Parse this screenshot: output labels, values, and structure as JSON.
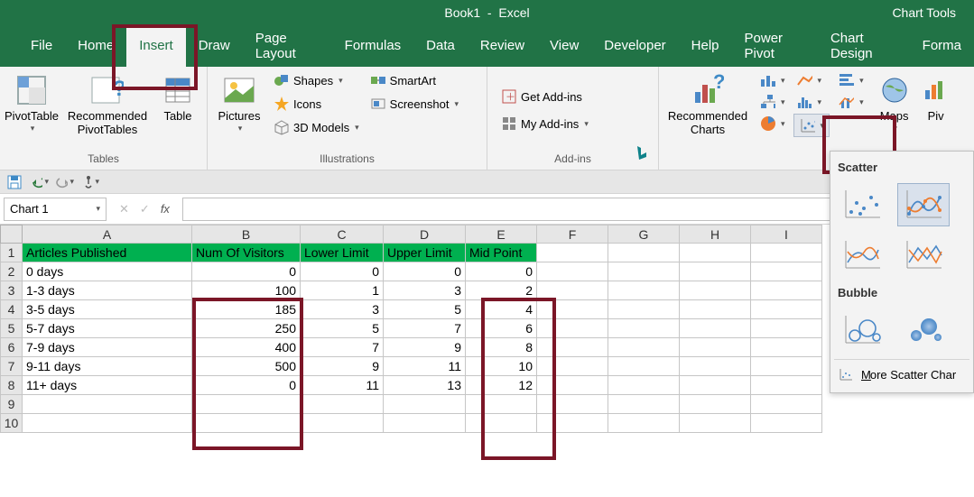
{
  "title": {
    "doc": "Book1",
    "app": "Excel",
    "context": "Chart Tools"
  },
  "tabs": [
    "File",
    "Home",
    "Insert",
    "Draw",
    "Page Layout",
    "Formulas",
    "Data",
    "Review",
    "View",
    "Developer",
    "Help",
    "Power Pivot",
    "Chart Design",
    "Forma"
  ],
  "active_tab": "Insert",
  "ribbon": {
    "tables": {
      "pivot": "PivotTable",
      "recpivot": "Recommended\nPivotTables",
      "table": "Table",
      "group": "Tables"
    },
    "illus": {
      "pictures": "Pictures",
      "shapes": "Shapes",
      "icons": "Icons",
      "models": "3D Models",
      "smartart": "SmartArt",
      "screenshot": "Screenshot",
      "group": "Illustrations"
    },
    "addins": {
      "get": "Get Add-ins",
      "my": "My Add-ins",
      "group": "Add-ins"
    },
    "charts": {
      "rec": "Recommended\nCharts",
      "maps": "Maps",
      "pivc": "Piv",
      "scatter_label": "Scatter"
    }
  },
  "name_box": "Chart 1",
  "scatter_menu": {
    "sect1": "Scatter",
    "sect2": "Bubble",
    "more": "More Scatter Char"
  },
  "columns": [
    "A",
    "B",
    "C",
    "D",
    "E",
    "F",
    "G",
    "H",
    "I"
  ],
  "row_headers": [
    1,
    2,
    3,
    4,
    5,
    6,
    7,
    8,
    9,
    10
  ],
  "table": {
    "headers": [
      "Articles Published",
      "Num Of Visitors",
      "Lower Limit",
      "Upper Limit",
      "Mid Point"
    ],
    "rows": [
      [
        "0 days",
        0,
        0,
        0,
        0
      ],
      [
        "1-3 days",
        100,
        1,
        3,
        2
      ],
      [
        "3-5 days",
        185,
        3,
        5,
        4
      ],
      [
        "5-7 days",
        250,
        5,
        7,
        6
      ],
      [
        "7-9 days",
        400,
        7,
        9,
        8
      ],
      [
        "9-11 days",
        500,
        9,
        11,
        10
      ],
      [
        "11+ days",
        0,
        11,
        13,
        12
      ]
    ]
  }
}
